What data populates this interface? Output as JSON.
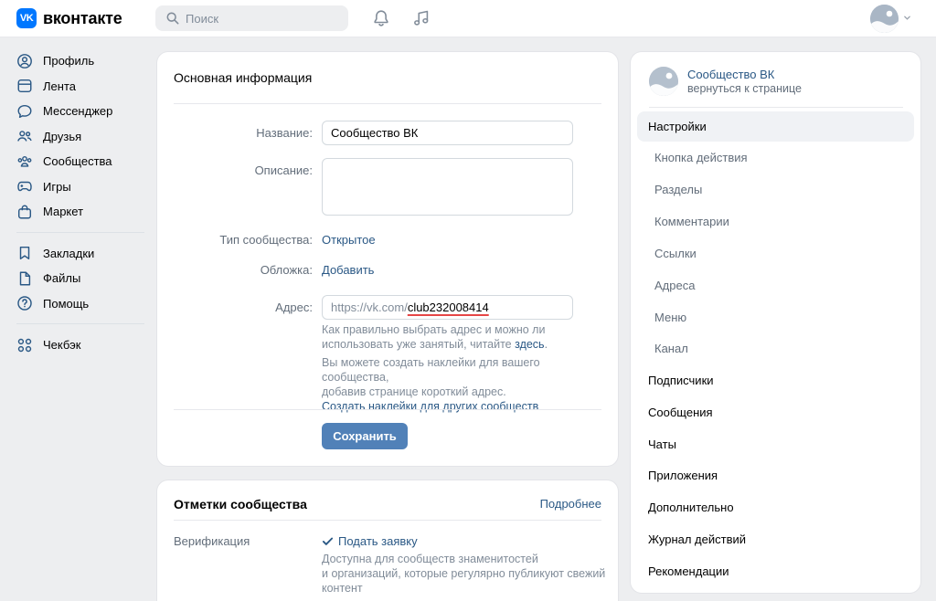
{
  "header": {
    "logo_text": "вконтакте",
    "logo_badge": "VK",
    "search_placeholder": "Поиск"
  },
  "leftnav": {
    "items": [
      {
        "label": "Профиль",
        "icon": "user-circle-icon"
      },
      {
        "label": "Лента",
        "icon": "feed-icon"
      },
      {
        "label": "Мессенджер",
        "icon": "message-icon"
      },
      {
        "label": "Друзья",
        "icon": "friends-icon"
      },
      {
        "label": "Сообщества",
        "icon": "communities-icon"
      },
      {
        "label": "Игры",
        "icon": "gamepad-icon"
      },
      {
        "label": "Маркет",
        "icon": "shopping-bag-icon"
      },
      {
        "label": "Закладки",
        "icon": "bookmark-icon"
      },
      {
        "label": "Файлы",
        "icon": "file-icon"
      },
      {
        "label": "Помощь",
        "icon": "help-icon"
      },
      {
        "label": "Чекбэк",
        "icon": "apps-icon"
      }
    ]
  },
  "main": {
    "title": "Основная информация",
    "fields": {
      "name_label": "Название:",
      "name_value": "Сообщество ВК",
      "description_label": "Описание:",
      "description_value": "",
      "type_label": "Тип сообщества:",
      "type_value": "Открытое",
      "cover_label": "Обложка:",
      "cover_value": "Добавить",
      "address_label": "Адрес:",
      "address_prefix": "https://vk.com/",
      "address_value": "club232008414"
    },
    "hint1_line1": "Как правильно выбрать адрес и можно ли",
    "hint1_line2": "использовать уже занятый, читайте ",
    "hint1_link": "здесь",
    "hint1_tail": ".",
    "hint2_line1": "Вы можете создать наклейки для вашего сообщества,",
    "hint2_line2": "добавив странице короткий адрес.",
    "hint2_link": "Создать наклейки для других сообществ",
    "save_label": "Сохранить"
  },
  "marks": {
    "title": "Отметки сообщества",
    "more_label": "Подробнее",
    "verification_label": "Верификация",
    "apply_label": "Подать заявку",
    "desc_line1": "Доступна для сообществ знаменитостей",
    "desc_line2": "и организаций, которые регулярно публикуют свежий",
    "desc_line3": "контент"
  },
  "right": {
    "community_name": "Сообщество ВК",
    "back_label": "вернуться к странице",
    "menu": [
      {
        "label": "Настройки",
        "active": true,
        "sub": false
      },
      {
        "label": "Кнопка действия",
        "active": false,
        "sub": true
      },
      {
        "label": "Разделы",
        "active": false,
        "sub": true
      },
      {
        "label": "Комментарии",
        "active": false,
        "sub": true
      },
      {
        "label": "Ссылки",
        "active": false,
        "sub": true
      },
      {
        "label": "Адреса",
        "active": false,
        "sub": true
      },
      {
        "label": "Меню",
        "active": false,
        "sub": true
      },
      {
        "label": "Канал",
        "active": false,
        "sub": true
      },
      {
        "label": "Подписчики",
        "active": false,
        "sub": false
      },
      {
        "label": "Сообщения",
        "active": false,
        "sub": false
      },
      {
        "label": "Чаты",
        "active": false,
        "sub": false
      },
      {
        "label": "Приложения",
        "active": false,
        "sub": false
      },
      {
        "label": "Дополнительно",
        "active": false,
        "sub": false
      },
      {
        "label": "Журнал действий",
        "active": false,
        "sub": false
      },
      {
        "label": "Рекомендации",
        "active": false,
        "sub": false
      }
    ]
  },
  "colors": {
    "accent": "#2a5885",
    "button": "#5181b8",
    "logo": "#0077ff",
    "background": "#edeef0",
    "underline": "#e64646"
  }
}
